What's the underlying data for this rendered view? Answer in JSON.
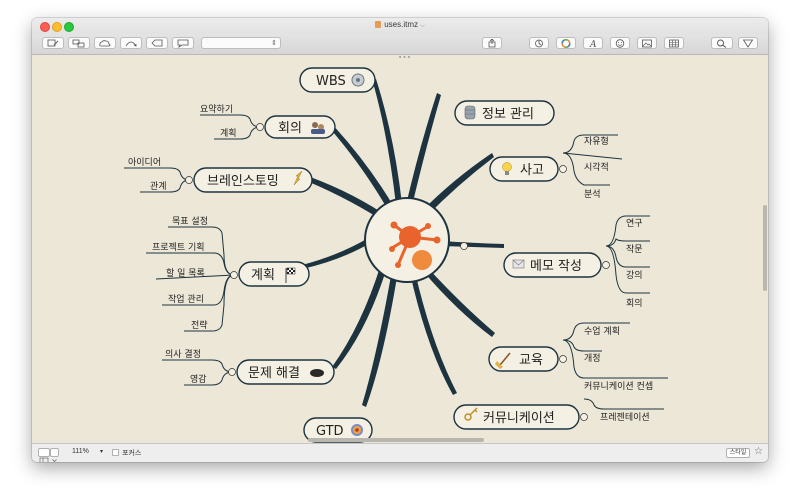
{
  "window": {
    "title": "uses.itmz",
    "title_chevron": "⌵"
  },
  "toolbar": {
    "icons": [
      "new-topic-icon",
      "add-child-icon",
      "cloud-icon",
      "relationship-icon",
      "callout-icon",
      "note-icon",
      "style-select",
      "share-icon",
      "notes-panel-icon",
      "color-wheel-icon",
      "font-icon",
      "emoji-icon",
      "image-icon",
      "table-icon",
      "search-icon",
      "filter-icon"
    ]
  },
  "mindmap": {
    "central_image": "idea-logo",
    "colors": {
      "branch": "#1d3440",
      "node_fill": "#f4f0e3",
      "canvas": "#ece7d7",
      "logo": "#e9632c",
      "logo_light": "#f08a3c"
    },
    "topics": [
      {
        "id": "wbs",
        "label": "WBS",
        "icon": "gear-icon"
      },
      {
        "id": "meeting",
        "label": "회의",
        "icon": "people-icon",
        "children": [
          "요약하기",
          "계획"
        ]
      },
      {
        "id": "brainstorm",
        "label": "브레인스토밍",
        "icon": "lightning-icon",
        "children": [
          "아이디어",
          "관계"
        ]
      },
      {
        "id": "plan",
        "label": "계획",
        "icon": "checkered-flag-icon",
        "children": [
          "목표 설정",
          "프로젝트 기획",
          "할 일 목록",
          "작업 관리",
          "전략"
        ]
      },
      {
        "id": "problem",
        "label": "문제 해결",
        "icon": "hat-icon",
        "children": [
          "의사 결정",
          "영감"
        ]
      },
      {
        "id": "gtd",
        "label": "GTD",
        "icon": "target-icon"
      },
      {
        "id": "info",
        "label": "정보 관리",
        "icon": "database-icon"
      },
      {
        "id": "thinking",
        "label": "사고",
        "icon": "lightbulb-icon",
        "children": [
          "자유형",
          "시각적",
          "분석"
        ]
      },
      {
        "id": "memo",
        "label": "메모 작성",
        "icon": "envelope-icon",
        "children": [
          "연구",
          "작문",
          "강의",
          "회의"
        ]
      },
      {
        "id": "education",
        "label": "교육",
        "icon": "broom-icon",
        "children": [
          "수업 계획",
          "개정",
          "커뮤니케이션 컨셉"
        ]
      },
      {
        "id": "communication",
        "label": "커뮤니케이션",
        "icon": "key-icon",
        "children": [
          "프레젠테이션"
        ]
      }
    ]
  },
  "statusbar": {
    "zoom": "111%",
    "focus_label": "포커스",
    "style_button": "스타일"
  }
}
